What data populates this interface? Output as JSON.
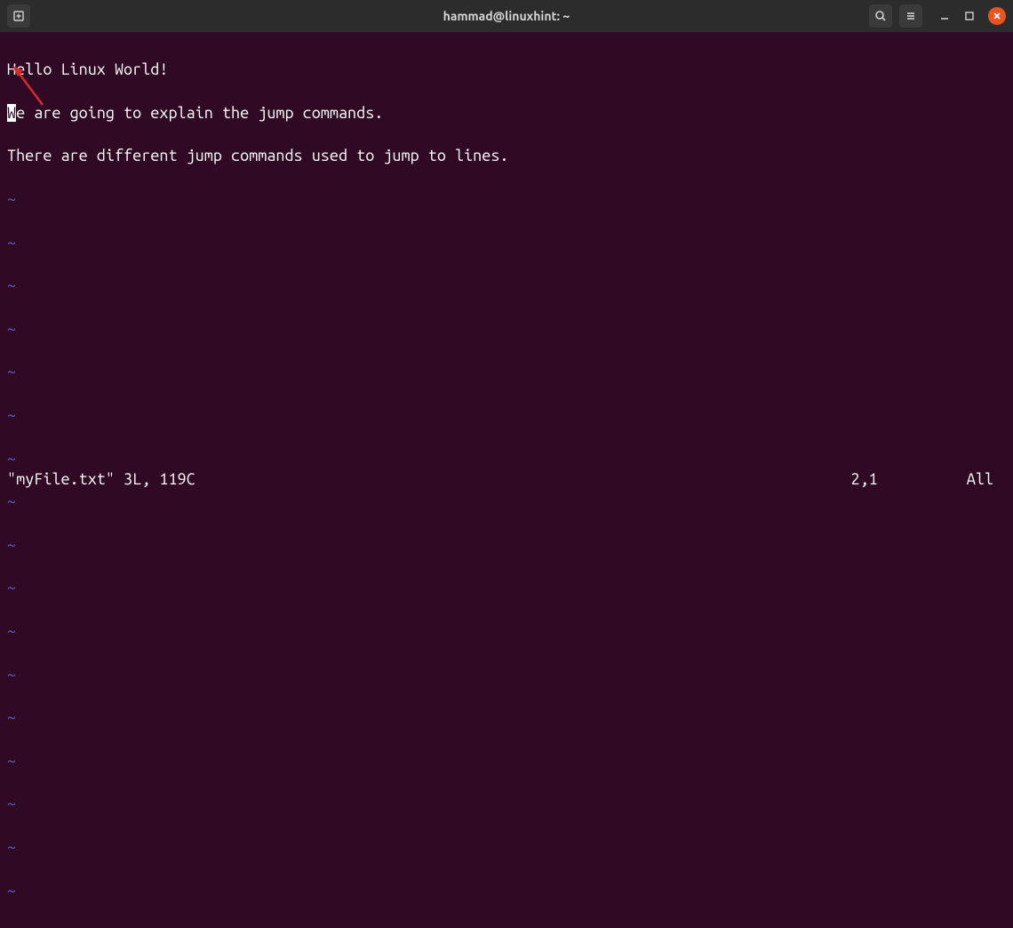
{
  "titlebar": {
    "title": "hammad@linuxhint: ~"
  },
  "editor": {
    "lines": [
      "Hello Linux World!",
      "We are going to explain the jump commands.",
      "There are different jump commands used to jump to lines."
    ],
    "cursor_char": "W",
    "line2_rest": "e are going to explain the jump commands.",
    "tilde": "~"
  },
  "status": {
    "file_info": "\"myFile.txt\" 3L, 119C",
    "position": "2,1",
    "scroll": "All"
  },
  "colors": {
    "background": "#300a24",
    "accent": "#e95420",
    "tilde": "#5f5fd7"
  }
}
